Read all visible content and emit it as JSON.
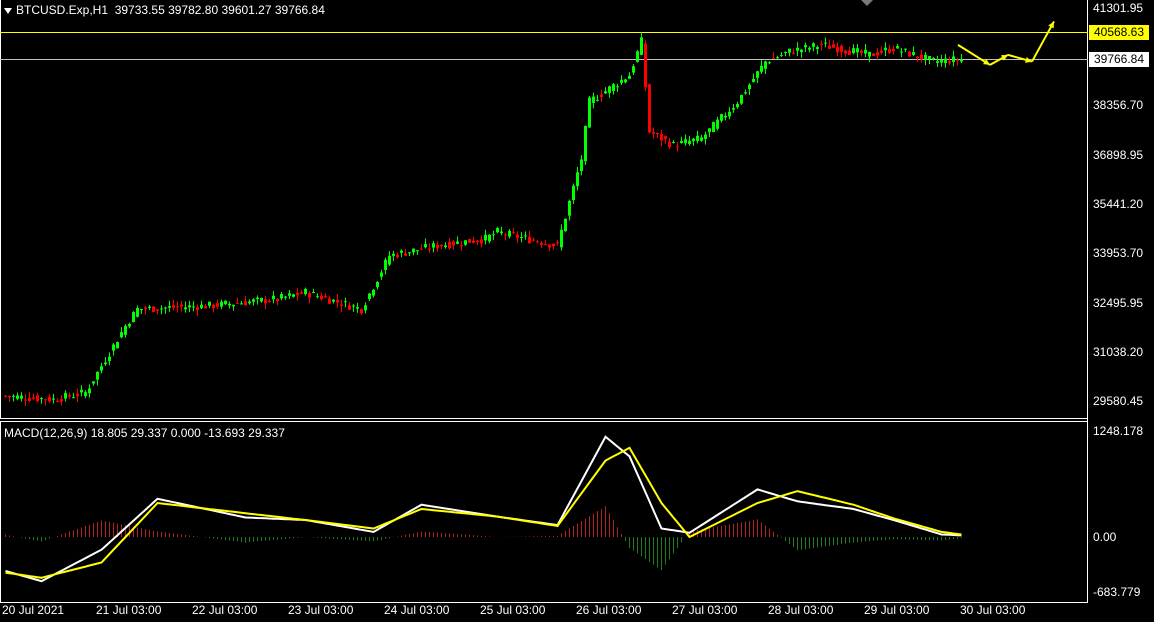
{
  "header": {
    "symbol_label": "BTCUSD.Exp,H1",
    "ohlc": "39733.55 39782.80 39601.27 39766.84"
  },
  "macd_panel": {
    "label": "MACD(12,26,9) 18.805 29.337 0.000 -13.693 29.337",
    "axis": [
      "1248.178",
      "0.00",
      "-683.779"
    ]
  },
  "price_axis": {
    "ticks": [
      "41301.95",
      "38356.70",
      "36898.95",
      "35441.20",
      "33953.70",
      "32495.95",
      "31038.20",
      "29580.45"
    ]
  },
  "price_lines": {
    "yellow_level": "40568.63",
    "current_bid": "39766.84"
  },
  "time_axis": [
    "20 Jul 2021",
    "21 Jul 03:00",
    "22 Jul 03:00",
    "23 Jul 03:00",
    "24 Jul 03:00",
    "25 Jul 03:00",
    "26 Jul 03:00",
    "27 Jul 03:00",
    "28 Jul 03:00",
    "29 Jul 03:00",
    "30 Jul 03:00"
  ],
  "colors": {
    "bull": "#00ff00",
    "bear": "#ff0000",
    "macd_line": "#ffffff",
    "signal_line": "#ffff00",
    "level_line": "#ffff00",
    "bid_line": "#c0c0c0",
    "frame": "#ffffff",
    "arrow": "#ffff00"
  },
  "chart_data": {
    "type": "candlestick",
    "symbol": "BTCUSD.Exp",
    "timeframe": "H1",
    "ylim": [
      29000,
      41600
    ],
    "anchors": [
      {
        "x": "20 Jul 00:00",
        "price": 29700
      },
      {
        "x": "20 Jul 12:00",
        "price": 29600
      },
      {
        "x": "20 Jul 20:00",
        "price": 29800
      },
      {
        "x": "21 Jul 02:00",
        "price": 31000
      },
      {
        "x": "21 Jul 06:00",
        "price": 31800
      },
      {
        "x": "21 Jul 09:00",
        "price": 32300
      },
      {
        "x": "22 Jul 03:00",
        "price": 32400
      },
      {
        "x": "22 Jul 20:00",
        "price": 32600
      },
      {
        "x": "23 Jul 03:00",
        "price": 32800
      },
      {
        "x": "23 Jul 17:00",
        "price": 32300
      },
      {
        "x": "24 Jul 00:00",
        "price": 33900
      },
      {
        "x": "24 Jul 12:00",
        "price": 34200
      },
      {
        "x": "25 Jul 00:00",
        "price": 34400
      },
      {
        "x": "25 Jul 03:00",
        "price": 34600
      },
      {
        "x": "25 Jul 18:00",
        "price": 34200
      },
      {
        "x": "26 Jul 00:00",
        "price": 36800
      },
      {
        "x": "26 Jul 02:00",
        "price": 38500
      },
      {
        "x": "26 Jul 12:00",
        "price": 39300
      },
      {
        "x": "26 Jul 15:00",
        "price": 40300
      },
      {
        "x": "26 Jul 17:00",
        "price": 37600
      },
      {
        "x": "26 Jul 23:00",
        "price": 37200
      },
      {
        "x": "27 Jul 06:00",
        "price": 37400
      },
      {
        "x": "27 Jul 15:00",
        "price": 38500
      },
      {
        "x": "27 Jul 22:00",
        "price": 39700
      },
      {
        "x": "28 Jul 04:00",
        "price": 40000
      },
      {
        "x": "28 Jul 12:00",
        "price": 40200
      },
      {
        "x": "29 Jul 00:00",
        "price": 39900
      },
      {
        "x": "29 Jul 06:00",
        "price": 40100
      },
      {
        "x": "29 Jul 16:00",
        "price": 39700
      },
      {
        "x": "29 Jul 23:00",
        "price": 39766.84
      }
    ],
    "macd_anchors": [
      {
        "x": "20 Jul 00:00",
        "macd": -400,
        "signal": -420
      },
      {
        "x": "20 Jul 09:00",
        "macd": -520,
        "signal": -480
      },
      {
        "x": "21 Jul 00:00",
        "macd": -150,
        "signal": -300
      },
      {
        "x": "21 Jul 14:00",
        "macd": 450,
        "signal": 400
      },
      {
        "x": "22 Jul 12:00",
        "macd": 230,
        "signal": 280
      },
      {
        "x": "23 Jul 03:00",
        "macd": 200,
        "signal": 200
      },
      {
        "x": "23 Jul 20:00",
        "macd": 60,
        "signal": 100
      },
      {
        "x": "24 Jul 08:00",
        "macd": 380,
        "signal": 330
      },
      {
        "x": "25 Jul 03:00",
        "macd": 240,
        "signal": 240
      },
      {
        "x": "25 Jul 18:00",
        "macd": 140,
        "signal": 130
      },
      {
        "x": "26 Jul 06:00",
        "macd": 1180,
        "signal": 900
      },
      {
        "x": "26 Jul 12:00",
        "macd": 950,
        "signal": 1050
      },
      {
        "x": "26 Jul 20:00",
        "macd": 100,
        "signal": 400
      },
      {
        "x": "27 Jul 03:00",
        "macd": 50,
        "signal": 0
      },
      {
        "x": "27 Jul 20:00",
        "macd": 560,
        "signal": 400
      },
      {
        "x": "28 Jul 06:00",
        "macd": 420,
        "signal": 540
      },
      {
        "x": "28 Jul 20:00",
        "macd": 330,
        "signal": 380
      },
      {
        "x": "29 Jul 06:00",
        "macd": 200,
        "signal": 220
      },
      {
        "x": "29 Jul 18:00",
        "macd": 30,
        "signal": 60
      },
      {
        "x": "29 Jul 23:00",
        "macd": 18.805,
        "signal": 29.337
      }
    ],
    "forecast_path": [
      39600,
      39900,
      39700,
      40900
    ]
  }
}
